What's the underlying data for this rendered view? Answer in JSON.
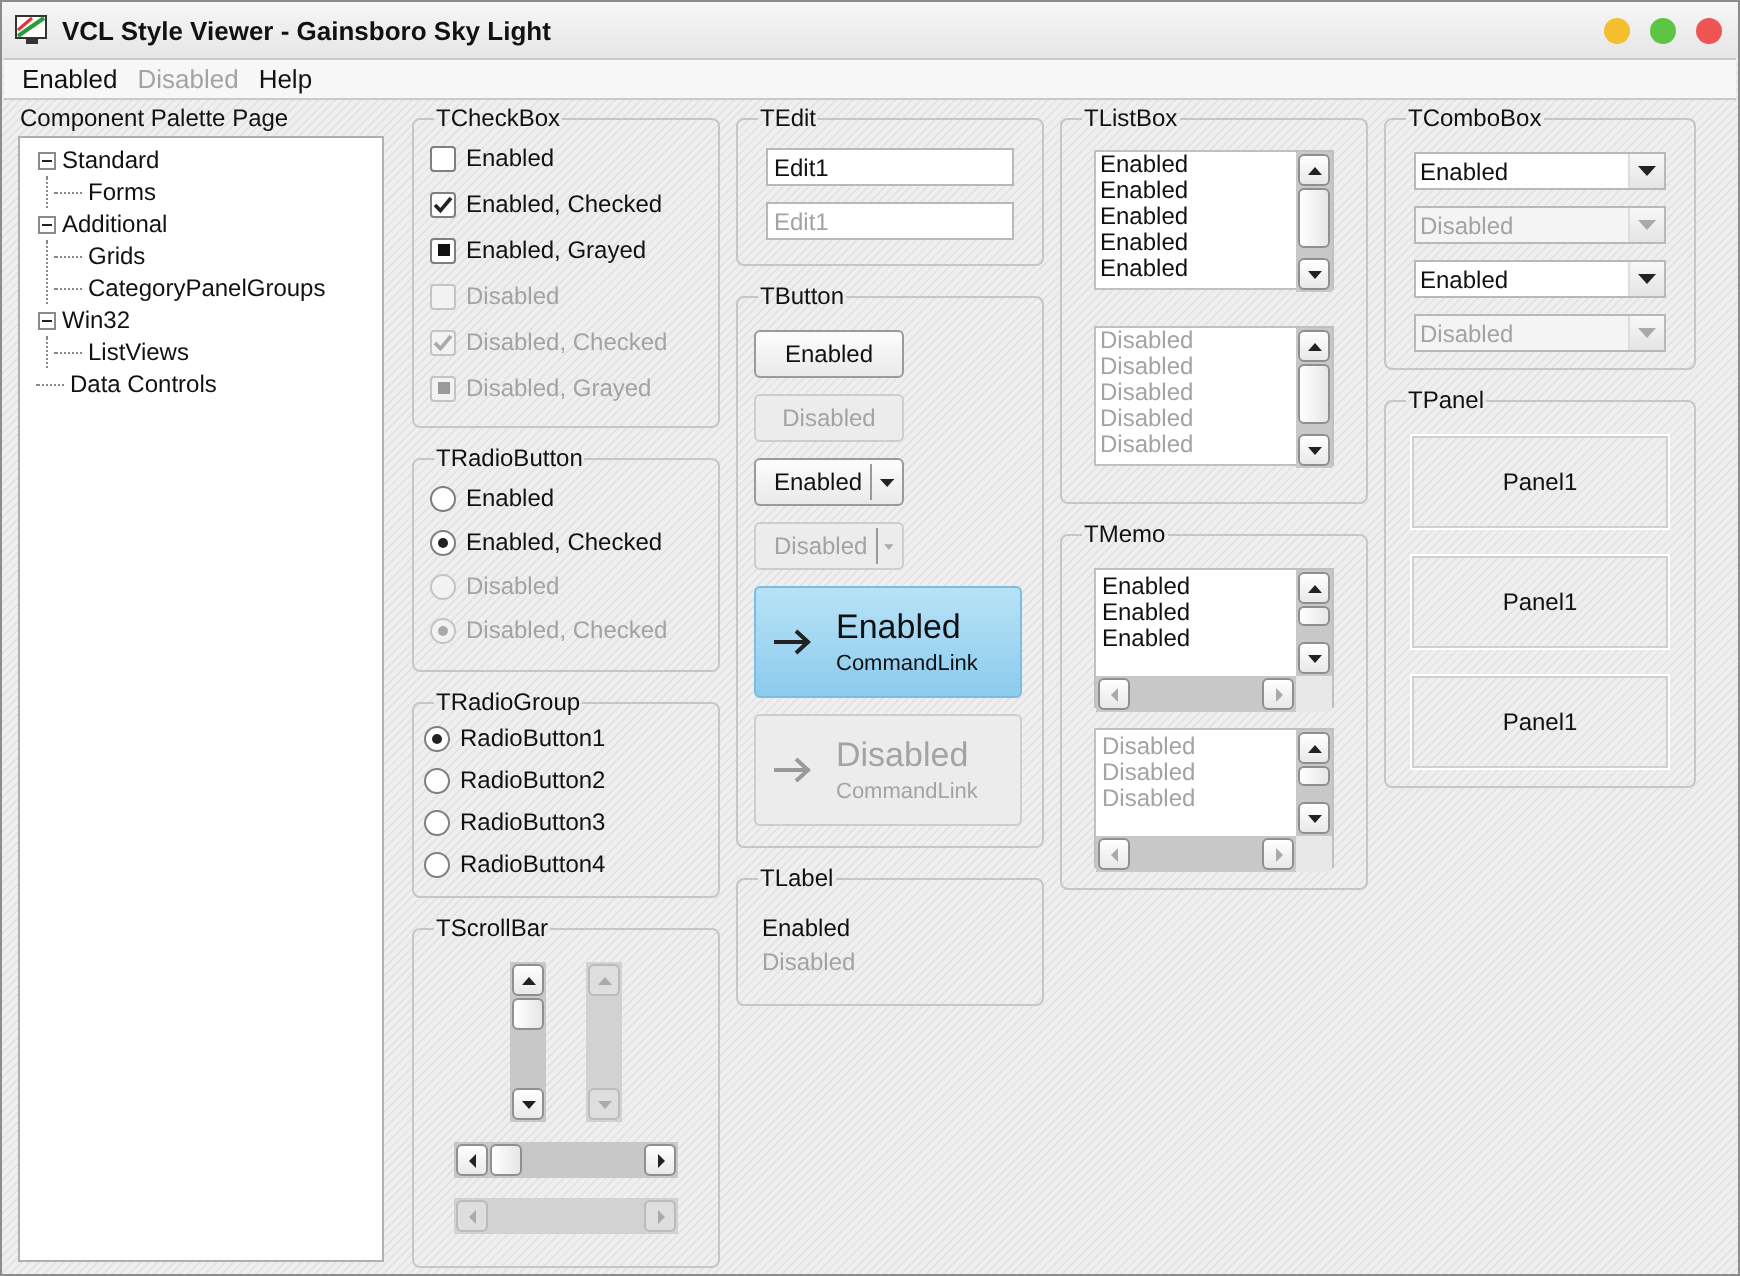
{
  "window": {
    "title": "VCL Style Viewer - Gainsboro Sky Light"
  },
  "menu": [
    {
      "label": "Enabled",
      "disabled": false
    },
    {
      "label": "Disabled",
      "disabled": true
    },
    {
      "label": "Help",
      "disabled": false
    }
  ],
  "palette": {
    "label": "Component Palette Page",
    "tree": [
      {
        "label": "Standard",
        "expanded": true,
        "children": [
          {
            "label": "Forms"
          }
        ]
      },
      {
        "label": "Additional",
        "expanded": true,
        "children": [
          {
            "label": "Grids"
          },
          {
            "label": "CategoryPanelGroups"
          }
        ]
      },
      {
        "label": "Win32",
        "expanded": true,
        "children": [
          {
            "label": "ListViews"
          }
        ]
      },
      {
        "label": "Data Controls"
      }
    ]
  },
  "checkboxes": {
    "title": "TCheckBox",
    "items": [
      {
        "kind": "unchecked",
        "label": "Enabled",
        "disabled": false
      },
      {
        "kind": "checked",
        "label": "Enabled, Checked",
        "disabled": false
      },
      {
        "kind": "grayed",
        "label": "Enabled, Grayed",
        "disabled": false
      },
      {
        "kind": "unchecked",
        "label": "Disabled",
        "disabled": true
      },
      {
        "kind": "checked",
        "label": "Disabled, Checked",
        "disabled": true
      },
      {
        "kind": "grayed",
        "label": "Disabled, Grayed",
        "disabled": true
      }
    ]
  },
  "radio_buttons": {
    "title": "TRadioButton",
    "items": [
      {
        "label": "Enabled",
        "selected": false,
        "disabled": false
      },
      {
        "label": "Enabled, Checked",
        "selected": true,
        "disabled": false
      },
      {
        "label": "Disabled",
        "selected": false,
        "disabled": true
      },
      {
        "label": "Disabled, Checked",
        "selected": true,
        "disabled": true
      }
    ]
  },
  "radio_group": {
    "title": "TRadioGroup",
    "items": [
      {
        "label": "RadioButton1",
        "selected": true
      },
      {
        "label": "RadioButton2",
        "selected": false
      },
      {
        "label": "RadioButton3",
        "selected": false
      },
      {
        "label": "RadioButton4",
        "selected": false
      }
    ]
  },
  "scrollbars": {
    "title": "TScrollBar",
    "items": [
      {
        "kind": "vertical",
        "disabled": false
      },
      {
        "kind": "vertical",
        "disabled": true
      },
      {
        "kind": "horizontal",
        "disabled": false
      },
      {
        "kind": "horizontal",
        "disabled": true
      }
    ]
  },
  "edit": {
    "title": "TEdit",
    "fields": [
      {
        "value": "Edit1",
        "disabled": false
      },
      {
        "value": "Edit1",
        "disabled": true
      }
    ]
  },
  "buttons": {
    "title": "TButton",
    "items": [
      {
        "kind": "push",
        "label": "Enabled",
        "disabled": false
      },
      {
        "kind": "push",
        "label": "Disabled",
        "disabled": true
      },
      {
        "kind": "split",
        "label": "Enabled",
        "disabled": false
      },
      {
        "kind": "split",
        "label": "Disabled",
        "disabled": true
      },
      {
        "kind": "commandlink",
        "label": "Enabled",
        "note": "CommandLink",
        "disabled": false
      },
      {
        "kind": "commandlink",
        "label": "Disabled",
        "note": "CommandLink",
        "disabled": true
      }
    ]
  },
  "labels": {
    "title": "TLabel",
    "items": [
      {
        "label": "Enabled",
        "disabled": false
      },
      {
        "label": "Disabled",
        "disabled": true
      }
    ]
  },
  "listboxes": {
    "title": "TListBox",
    "lists": [
      {
        "disabled": false,
        "items": [
          "Enabled",
          "Enabled",
          "Enabled",
          "Enabled",
          "Enabled"
        ]
      },
      {
        "disabled": true,
        "items": [
          "Disabled",
          "Disabled",
          "Disabled",
          "Disabled",
          "Disabled"
        ]
      }
    ]
  },
  "memos": {
    "title": "TMemo",
    "memos": [
      {
        "disabled": false,
        "lines": [
          "Enabled",
          "Enabled",
          "Enabled"
        ]
      },
      {
        "disabled": true,
        "lines": [
          "Disabled",
          "Disabled",
          "Disabled"
        ]
      }
    ]
  },
  "comboboxes": {
    "title": "TComboBox",
    "items": [
      {
        "value": "Enabled",
        "disabled": false
      },
      {
        "value": "Disabled",
        "disabled": true
      },
      {
        "value": "Enabled",
        "disabled": false
      },
      {
        "value": "Disabled",
        "disabled": true
      }
    ]
  },
  "panels": {
    "title": "TPanel",
    "items": [
      "Panel1",
      "Panel1",
      "Panel1"
    ]
  }
}
